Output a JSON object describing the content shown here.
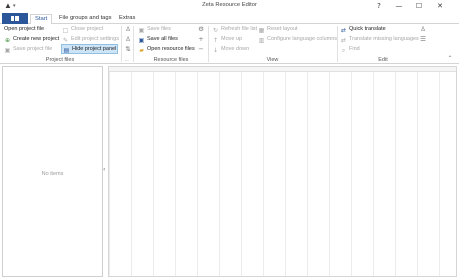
{
  "window": {
    "title": "Zeta Resource Editor",
    "app_icon": "app-logo-icon",
    "qat_icon": "dropdown-arrow-icon",
    "controls": {
      "help": "?",
      "minimize": "—",
      "maximize": "☐",
      "close": "✕"
    }
  },
  "tabs": {
    "file_icon": "file-menu-icon",
    "start": "Start",
    "file_groups": "File groups and tags",
    "extras": "Extras"
  },
  "ribbon": {
    "project_files": {
      "label": "Project files",
      "open_project_file": "Open project file",
      "create_new_project": "Create new project",
      "save_project_file": "Save project file",
      "close_project": "Close project",
      "edit_project_settings": "Edit project settings",
      "hide_project_panel": "Hide project panel",
      "overflow": "..."
    },
    "resource_files": {
      "label": "Resource files",
      "save_files": "Save files",
      "save_all_files": "Save all files",
      "open_resource_files": "Open resource files"
    },
    "view": {
      "label": "View",
      "refresh_file_list": "Refresh file list",
      "move_up": "Move up",
      "move_down": "Move down",
      "reset_layout": "Reset layout",
      "configure_language_columns": "Configure language columns"
    },
    "edit": {
      "label": "Edit",
      "quick_translate": "Quick translate",
      "translate_missing_languages": "Translate missing languages",
      "find": "Find"
    },
    "collapse_icon": "collapse-ribbon-icon"
  },
  "left_panel": {
    "empty_text": "No items"
  },
  "colors": {
    "accent": "#2b579a",
    "highlight_bg": "#cde4f7",
    "disabled_text": "#a7a7a7"
  }
}
